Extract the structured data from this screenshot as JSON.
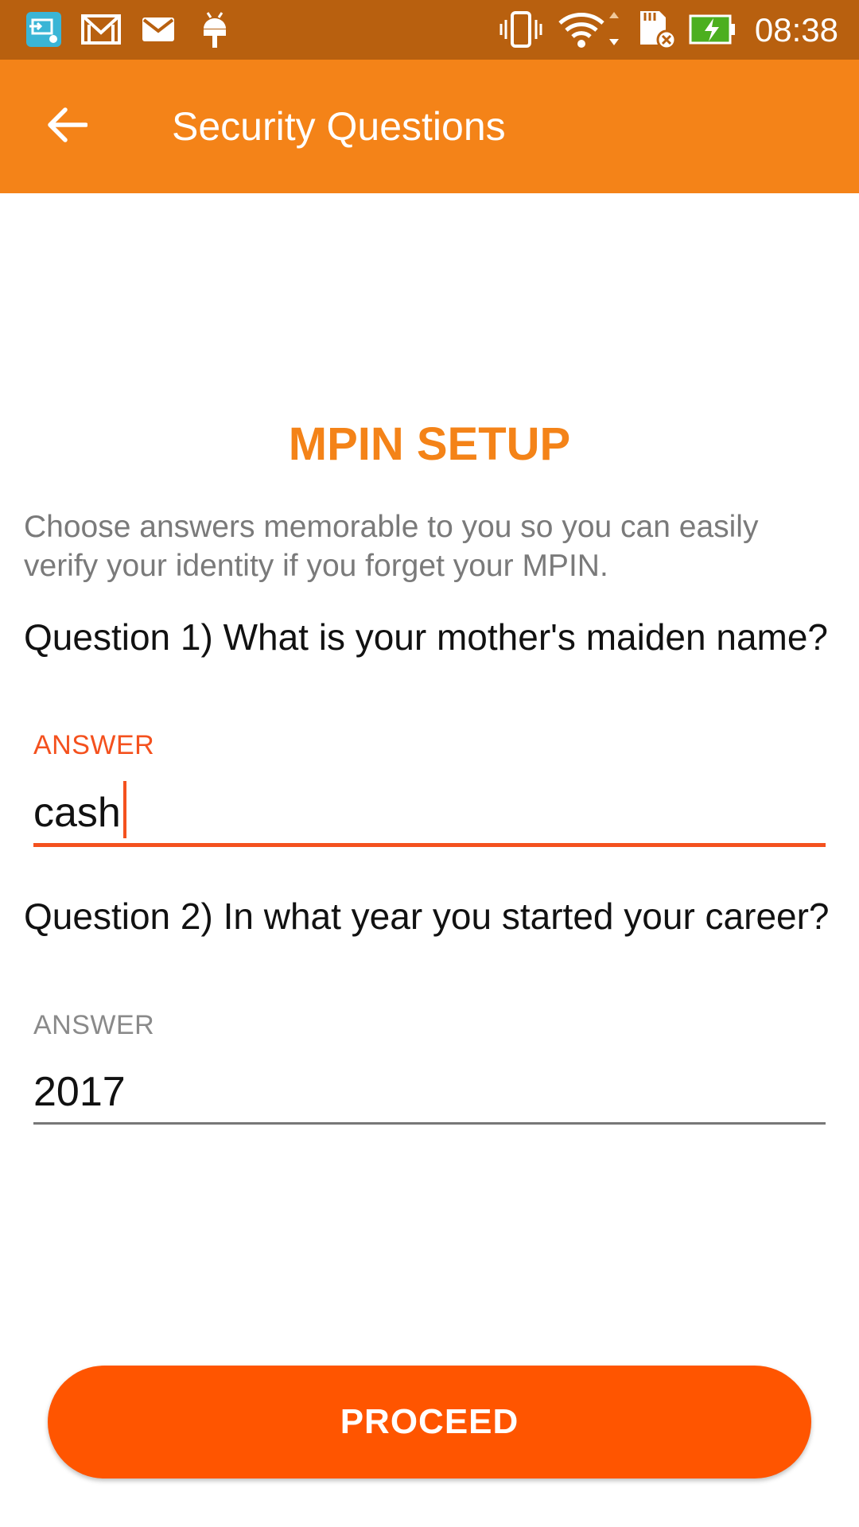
{
  "status_bar": {
    "time": "08:38",
    "left_icons": [
      "screen-mirror-icon",
      "gmail-icon",
      "mail-icon",
      "android-debug-icon"
    ],
    "right_icons": [
      "vibrate-icon",
      "wifi-icon",
      "sd-card-icon",
      "battery-charging-icon"
    ]
  },
  "app_bar": {
    "title": "Security Questions",
    "back_icon": "arrow-left-icon"
  },
  "main": {
    "heading": "MPIN SETUP",
    "intro": "Choose answers memorable to you so you can easily verify your identity if you forget your MPIN.",
    "questions": [
      {
        "text": "Question 1) What is your mother's maiden name?",
        "label": "ANSWER",
        "value": "cash",
        "focused": true
      },
      {
        "text": "Question 2) In what year you started your career?",
        "label": "ANSWER",
        "value": "2017",
        "focused": false
      }
    ],
    "proceed_label": "PROCEED"
  },
  "colors": {
    "status_bar": "#b8600f",
    "app_bar": "#f48318",
    "heading": "#f48318",
    "focus_accent": "#f4511e",
    "button": "#ff5500"
  }
}
